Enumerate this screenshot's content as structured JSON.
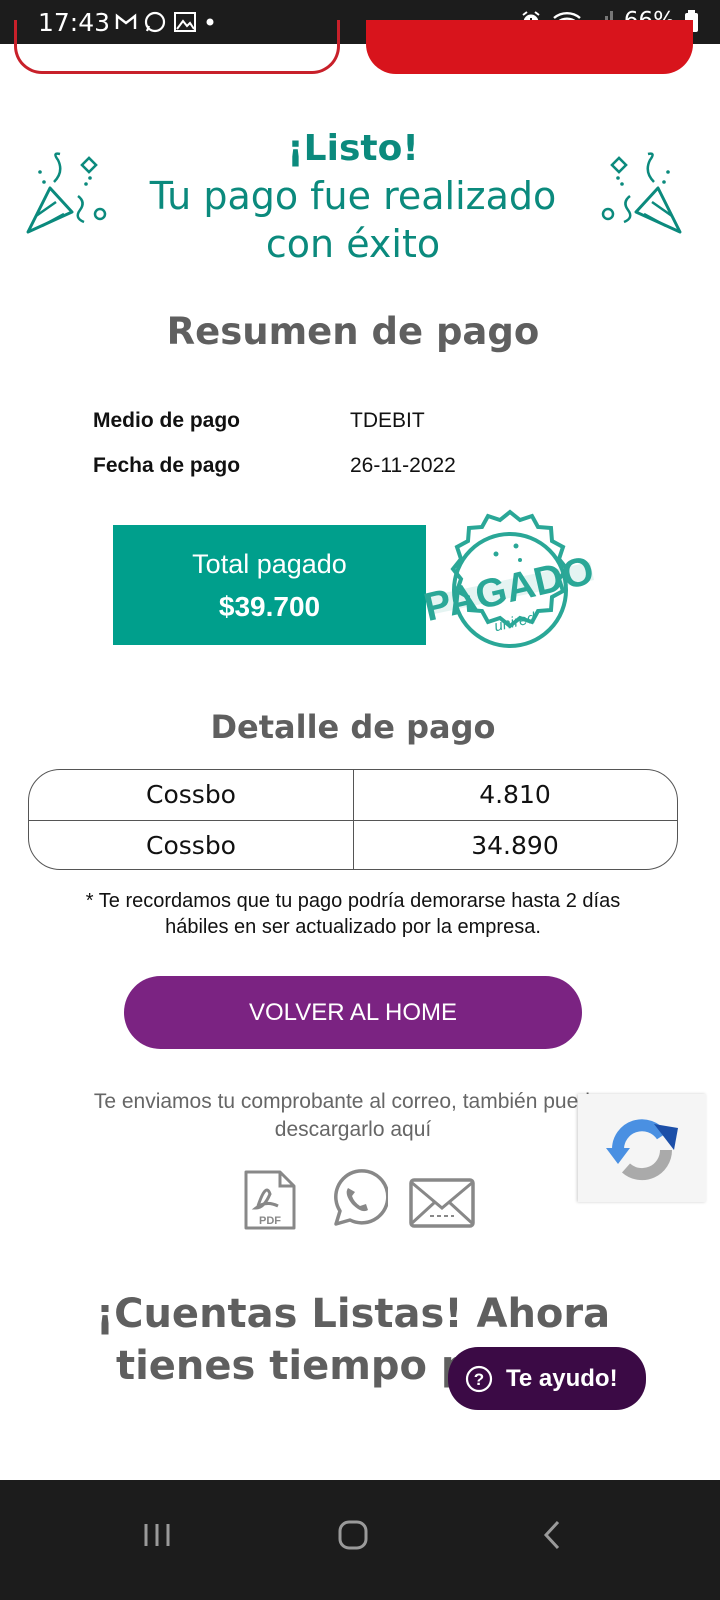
{
  "status_bar": {
    "time": "17:43",
    "battery": "66%"
  },
  "success": {
    "heading": "¡Listo!",
    "message": "Tu pago fue realizado con éxito"
  },
  "summary": {
    "title": "Resumen de pago",
    "rows": [
      {
        "label": "Medio de pago",
        "value": "TDEBIT"
      },
      {
        "label": "Fecha de pago",
        "value": "26-11-2022"
      }
    ],
    "total_label": "Total pagado",
    "total_amount": "$39.700",
    "stamp_text": "PAGADO",
    "stamp_brand": "unired"
  },
  "detail": {
    "title": "Detalle de pago",
    "rows": [
      {
        "name": "Cossbo",
        "amount": "4.810"
      },
      {
        "name": "Cossbo",
        "amount": "34.890"
      }
    ]
  },
  "note": "* Te recordamos que tu pago podría demorarse hasta 2 días hábiles en ser actualizado por la empresa.",
  "home_button": "VOLVER AL HOME",
  "email_note": "Te enviamos tu comprobante al correo, también puedes descargarlo aquí",
  "share_icons": [
    "pdf-icon",
    "whatsapp-icon",
    "mail-icon"
  ],
  "promo_title": "¡Cuentas Listas! Ahora tienes tiempo para ti",
  "help_button": "Te ayudo!",
  "colors": {
    "brand_teal": "#009f8c",
    "success_text": "#0b8a7d",
    "home_button": "#7b2382",
    "help_button": "#3b0a45",
    "top_red": "#d8141c"
  }
}
